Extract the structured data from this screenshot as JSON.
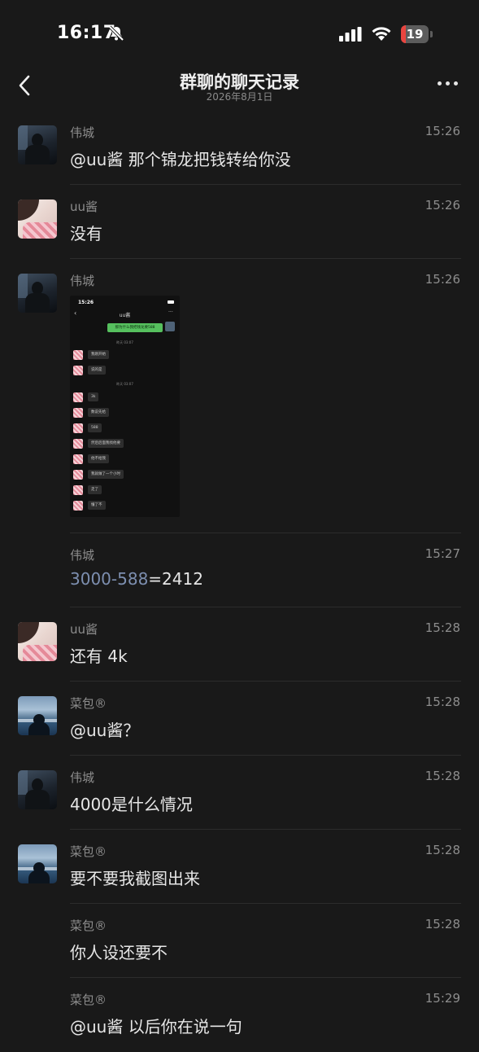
{
  "status_bar": {
    "time": "16:17",
    "battery_percent": "19",
    "battery_level": 0.19
  },
  "header": {
    "title": "群聊的聊天记录",
    "subtitle": "2026年8月1日"
  },
  "messages": [
    {
      "sender": "伟城",
      "avatar": "weicheng",
      "time": "15:26",
      "text": "@uu酱 那个锦龙把钱转给你没"
    },
    {
      "sender": "uu酱",
      "avatar": "uu",
      "time": "15:26",
      "text": "没有"
    },
    {
      "sender": "伟城",
      "avatar": "weicheng",
      "time": "15:26",
      "type": "image",
      "image": {
        "time": "15:26",
        "title": "uu酱",
        "sent_message": "那为什么我把钱龙要588",
        "time_label_1": "昨天 03:07",
        "time_label_2": "昨天 03:07",
        "bubbles": [
          "我刚开始",
          "说的是",
          "3k",
          "数说先给",
          "588",
          "然后后面我找他要",
          "他不给我",
          "我就做了一个小时",
          "走了",
          "懂了不"
        ]
      }
    },
    {
      "sender": "伟城",
      "avatar": "none",
      "time": "15:27",
      "text_link": "3000-588",
      "text_rest": "=2412"
    },
    {
      "sender": "uu酱",
      "avatar": "uu",
      "time": "15:28",
      "text": "还有 4k"
    },
    {
      "sender": "菜包®",
      "avatar": "caibao",
      "time": "15:28",
      "text": "@uu酱？"
    },
    {
      "sender": "伟城",
      "avatar": "weicheng",
      "time": "15:28",
      "text": "4000是什么情况"
    },
    {
      "sender": "菜包®",
      "avatar": "caibao",
      "time": "15:28",
      "text": "要不要我截图出来"
    },
    {
      "sender": "菜包®",
      "avatar": "none",
      "time": "15:28",
      "text": "你人设还要不"
    },
    {
      "sender": "菜包®",
      "avatar": "none",
      "time": "15:29",
      "text": "@uu酱 以后你在说一句"
    }
  ]
}
